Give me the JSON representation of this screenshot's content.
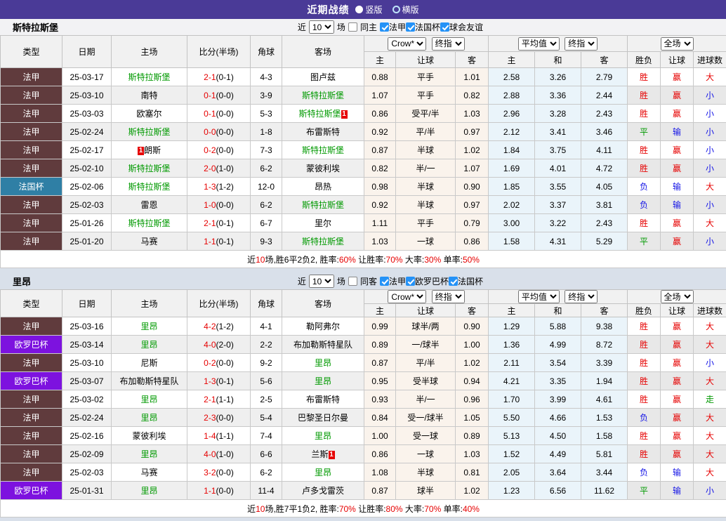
{
  "topbar": {
    "title": "近期战绩",
    "vertical": "竖版",
    "horizontal": "横版"
  },
  "shared": {
    "near": "近",
    "matches": "场"
  },
  "selects": {
    "count": "10",
    "provider": "Crow*",
    "final": "终指",
    "avg": "平均值",
    "avg_final": "终指",
    "scope": "全场"
  },
  "columns": {
    "type": "类型",
    "date": "日期",
    "home": "主场",
    "score": "比分(半场)",
    "corner": "角球",
    "away": "客场",
    "h": "主",
    "handicap": "让球",
    "a": "客",
    "avg_h": "主",
    "avg_d": "和",
    "avg_a": "客",
    "wdl": "胜负",
    "asian": "让球",
    "goals": "进球数"
  },
  "type_colors": {
    "法甲": "#603B3D",
    "法国杯": "#2F7FA5",
    "欧罗巴杯": "#7D12DF"
  },
  "tables": [
    {
      "team": "斯特拉斯堡",
      "same": "同主",
      "leagues": [
        "法甲",
        "法国杯",
        "球会友谊"
      ],
      "rows": [
        {
          "type": "法甲",
          "date": "25-03-17",
          "home": {
            "name": "斯特拉斯堡",
            "team": true
          },
          "score": "2-1",
          "half": "(0-1)",
          "corner": "4-3",
          "away": {
            "name": "图卢兹"
          },
          "odds": [
            "0.88",
            "平手",
            "1.01"
          ],
          "avg": [
            "2.58",
            "3.26",
            "2.79"
          ],
          "res": [
            [
              "胜",
              "r"
            ],
            [
              "赢",
              "r"
            ],
            [
              "大",
              "r"
            ]
          ]
        },
        {
          "type": "法甲",
          "date": "25-03-10",
          "home": {
            "name": "南特"
          },
          "score": "0-1",
          "half": "(0-0)",
          "corner": "3-9",
          "away": {
            "name": "斯特拉斯堡",
            "team": true
          },
          "odds": [
            "1.07",
            "平手",
            "0.82"
          ],
          "avg": [
            "2.88",
            "3.36",
            "2.44"
          ],
          "res": [
            [
              "胜",
              "r"
            ],
            [
              "赢",
              "r"
            ],
            [
              "小",
              "b"
            ]
          ]
        },
        {
          "type": "法甲",
          "date": "25-03-03",
          "home": {
            "name": "欧塞尔"
          },
          "score": "0-1",
          "half": "(0-0)",
          "corner": "5-3",
          "away": {
            "name": "斯特拉斯堡",
            "team": true,
            "badge": "1",
            "badge_pos": "after"
          },
          "odds": [
            "0.86",
            "受平/半",
            "1.03"
          ],
          "avg": [
            "2.96",
            "3.28",
            "2.43"
          ],
          "res": [
            [
              "胜",
              "r"
            ],
            [
              "赢",
              "r"
            ],
            [
              "小",
              "b"
            ]
          ]
        },
        {
          "type": "法甲",
          "date": "25-02-24",
          "home": {
            "name": "斯特拉斯堡",
            "team": true
          },
          "score": "0-0",
          "half": "(0-0)",
          "corner": "1-8",
          "away": {
            "name": "布雷斯特"
          },
          "odds": [
            "0.92",
            "平/半",
            "0.97"
          ],
          "avg": [
            "2.12",
            "3.41",
            "3.46"
          ],
          "res": [
            [
              "平",
              "g"
            ],
            [
              "输",
              "b"
            ],
            [
              "小",
              "b"
            ]
          ]
        },
        {
          "type": "法甲",
          "date": "25-02-17",
          "home": {
            "name": "朗斯",
            "badge": "1",
            "badge_pos": "before"
          },
          "score": "0-2",
          "half": "(0-0)",
          "corner": "7-3",
          "away": {
            "name": "斯特拉斯堡",
            "team": true
          },
          "odds": [
            "0.87",
            "半球",
            "1.02"
          ],
          "avg": [
            "1.84",
            "3.75",
            "4.11"
          ],
          "res": [
            [
              "胜",
              "r"
            ],
            [
              "赢",
              "r"
            ],
            [
              "小",
              "b"
            ]
          ]
        },
        {
          "type": "法甲",
          "date": "25-02-10",
          "home": {
            "name": "斯特拉斯堡",
            "team": true
          },
          "score": "2-0",
          "half": "(1-0)",
          "corner": "6-2",
          "away": {
            "name": "蒙彼利埃"
          },
          "odds": [
            "0.82",
            "半/一",
            "1.07"
          ],
          "avg": [
            "1.69",
            "4.01",
            "4.72"
          ],
          "res": [
            [
              "胜",
              "r"
            ],
            [
              "赢",
              "r"
            ],
            [
              "小",
              "b"
            ]
          ]
        },
        {
          "type": "法国杯",
          "date": "25-02-06",
          "home": {
            "name": "斯特拉斯堡",
            "team": true
          },
          "score": "1-3",
          "half": "(1-2)",
          "corner": "12-0",
          "away": {
            "name": "昂热"
          },
          "odds": [
            "0.98",
            "半球",
            "0.90"
          ],
          "avg": [
            "1.85",
            "3.55",
            "4.05"
          ],
          "res": [
            [
              "负",
              "b"
            ],
            [
              "输",
              "b"
            ],
            [
              "大",
              "r"
            ]
          ]
        },
        {
          "type": "法甲",
          "date": "25-02-03",
          "home": {
            "name": "雷恩"
          },
          "score": "1-0",
          "half": "(0-0)",
          "corner": "6-2",
          "away": {
            "name": "斯特拉斯堡",
            "team": true
          },
          "odds": [
            "0.92",
            "半球",
            "0.97"
          ],
          "avg": [
            "2.02",
            "3.37",
            "3.81"
          ],
          "res": [
            [
              "负",
              "b"
            ],
            [
              "输",
              "b"
            ],
            [
              "小",
              "b"
            ]
          ]
        },
        {
          "type": "法甲",
          "date": "25-01-26",
          "home": {
            "name": "斯特拉斯堡",
            "team": true
          },
          "score": "2-1",
          "half": "(0-1)",
          "corner": "6-7",
          "away": {
            "name": "里尔"
          },
          "odds": [
            "1.11",
            "平手",
            "0.79"
          ],
          "avg": [
            "3.00",
            "3.22",
            "2.43"
          ],
          "res": [
            [
              "胜",
              "r"
            ],
            [
              "赢",
              "r"
            ],
            [
              "大",
              "r"
            ]
          ]
        },
        {
          "type": "法甲",
          "date": "25-01-20",
          "home": {
            "name": "马赛"
          },
          "score": "1-1",
          "half": "(0-1)",
          "corner": "9-3",
          "away": {
            "name": "斯特拉斯堡",
            "team": true
          },
          "odds": [
            "1.03",
            "一球",
            "0.86"
          ],
          "avg": [
            "1.58",
            "4.31",
            "5.29"
          ],
          "res": [
            [
              "平",
              "g"
            ],
            [
              "赢",
              "r"
            ],
            [
              "小",
              "b"
            ]
          ]
        }
      ],
      "summary": [
        {
          "t": "近"
        },
        {
          "t": "10",
          "red": true
        },
        {
          "t": "场,胜6平2负2, 胜率:"
        },
        {
          "t": "60%",
          "red": true
        },
        {
          "t": " 让胜率:"
        },
        {
          "t": "70%",
          "red": true
        },
        {
          "t": " 大率:"
        },
        {
          "t": "30%",
          "red": true
        },
        {
          "t": " 单率:"
        },
        {
          "t": "50%",
          "red": true
        }
      ]
    },
    {
      "team": "里昂",
      "same": "同客",
      "leagues": [
        "法甲",
        "欧罗巴杯",
        "法国杯"
      ],
      "rows": [
        {
          "type": "法甲",
          "date": "25-03-16",
          "home": {
            "name": "里昂",
            "team": true
          },
          "score": "4-2",
          "half": "(1-2)",
          "corner": "4-1",
          "away": {
            "name": "勒阿弗尔"
          },
          "odds": [
            "0.99",
            "球半/两",
            "0.90"
          ],
          "avg": [
            "1.29",
            "5.88",
            "9.38"
          ],
          "res": [
            [
              "胜",
              "r"
            ],
            [
              "赢",
              "r"
            ],
            [
              "大",
              "r"
            ]
          ]
        },
        {
          "type": "欧罗巴杯",
          "date": "25-03-14",
          "home": {
            "name": "里昂",
            "team": true
          },
          "score": "4-0",
          "half": "(2-0)",
          "corner": "2-2",
          "away": {
            "name": "布加勒斯特星队"
          },
          "odds": [
            "0.89",
            "一/球半",
            "1.00"
          ],
          "avg": [
            "1.36",
            "4.99",
            "8.72"
          ],
          "res": [
            [
              "胜",
              "r"
            ],
            [
              "赢",
              "r"
            ],
            [
              "大",
              "r"
            ]
          ]
        },
        {
          "type": "法甲",
          "date": "25-03-10",
          "home": {
            "name": "尼斯"
          },
          "score": "0-2",
          "half": "(0-0)",
          "corner": "9-2",
          "away": {
            "name": "里昂",
            "team": true
          },
          "odds": [
            "0.87",
            "平/半",
            "1.02"
          ],
          "avg": [
            "2.11",
            "3.54",
            "3.39"
          ],
          "res": [
            [
              "胜",
              "r"
            ],
            [
              "赢",
              "r"
            ],
            [
              "小",
              "b"
            ]
          ]
        },
        {
          "type": "欧罗巴杯",
          "date": "25-03-07",
          "home": {
            "name": "布加勒斯特星队"
          },
          "score": "1-3",
          "half": "(0-1)",
          "corner": "5-6",
          "away": {
            "name": "里昂",
            "team": true
          },
          "odds": [
            "0.95",
            "受半球",
            "0.94"
          ],
          "avg": [
            "4.21",
            "3.35",
            "1.94"
          ],
          "res": [
            [
              "胜",
              "r"
            ],
            [
              "赢",
              "r"
            ],
            [
              "大",
              "r"
            ]
          ]
        },
        {
          "type": "法甲",
          "date": "25-03-02",
          "home": {
            "name": "里昂",
            "team": true
          },
          "score": "2-1",
          "half": "(1-1)",
          "corner": "2-5",
          "away": {
            "name": "布雷斯特"
          },
          "odds": [
            "0.93",
            "半/一",
            "0.96"
          ],
          "avg": [
            "1.70",
            "3.99",
            "4.61"
          ],
          "res": [
            [
              "胜",
              "r"
            ],
            [
              "赢",
              "r"
            ],
            [
              "走",
              "g"
            ]
          ]
        },
        {
          "type": "法甲",
          "date": "25-02-24",
          "home": {
            "name": "里昂",
            "team": true
          },
          "score": "2-3",
          "half": "(0-0)",
          "corner": "5-4",
          "away": {
            "name": "巴黎圣日尔曼"
          },
          "odds": [
            "0.84",
            "受一/球半",
            "1.05"
          ],
          "avg": [
            "5.50",
            "4.66",
            "1.53"
          ],
          "res": [
            [
              "负",
              "b"
            ],
            [
              "赢",
              "r"
            ],
            [
              "大",
              "r"
            ]
          ]
        },
        {
          "type": "法甲",
          "date": "25-02-16",
          "home": {
            "name": "蒙彼利埃"
          },
          "score": "1-4",
          "half": "(1-1)",
          "corner": "7-4",
          "away": {
            "name": "里昂",
            "team": true
          },
          "odds": [
            "1.00",
            "受一球",
            "0.89"
          ],
          "avg": [
            "5.13",
            "4.50",
            "1.58"
          ],
          "res": [
            [
              "胜",
              "r"
            ],
            [
              "赢",
              "r"
            ],
            [
              "大",
              "r"
            ]
          ]
        },
        {
          "type": "法甲",
          "date": "25-02-09",
          "home": {
            "name": "里昂",
            "team": true
          },
          "score": "4-0",
          "half": "(1-0)",
          "corner": "6-6",
          "away": {
            "name": "兰斯",
            "badge": "1",
            "badge_pos": "after"
          },
          "odds": [
            "0.86",
            "一球",
            "1.03"
          ],
          "avg": [
            "1.52",
            "4.49",
            "5.81"
          ],
          "res": [
            [
              "胜",
              "r"
            ],
            [
              "赢",
              "r"
            ],
            [
              "大",
              "r"
            ]
          ]
        },
        {
          "type": "法甲",
          "date": "25-02-03",
          "home": {
            "name": "马赛"
          },
          "score": "3-2",
          "half": "(0-0)",
          "corner": "6-2",
          "away": {
            "name": "里昂",
            "team": true
          },
          "odds": [
            "1.08",
            "半球",
            "0.81"
          ],
          "avg": [
            "2.05",
            "3.64",
            "3.44"
          ],
          "res": [
            [
              "负",
              "b"
            ],
            [
              "输",
              "b"
            ],
            [
              "大",
              "r"
            ]
          ]
        },
        {
          "type": "欧罗巴杯",
          "date": "25-01-31",
          "home": {
            "name": "里昂",
            "team": true
          },
          "score": "1-1",
          "half": "(0-0)",
          "corner": "11-4",
          "away": {
            "name": "卢多戈雷茨"
          },
          "odds": [
            "0.87",
            "球半",
            "1.02"
          ],
          "avg": [
            "1.23",
            "6.56",
            "11.62"
          ],
          "res": [
            [
              "平",
              "g"
            ],
            [
              "输",
              "b"
            ],
            [
              "小",
              "b"
            ]
          ]
        }
      ],
      "summary": [
        {
          "t": "近"
        },
        {
          "t": "10",
          "red": true
        },
        {
          "t": "场,胜7平1负2, 胜率:"
        },
        {
          "t": "70%",
          "red": true
        },
        {
          "t": " 让胜率:"
        },
        {
          "t": "80%",
          "red": true
        },
        {
          "t": " 大率:"
        },
        {
          "t": "70%",
          "red": true
        },
        {
          "t": " 单率:"
        },
        {
          "t": "40%",
          "red": true
        }
      ]
    }
  ]
}
